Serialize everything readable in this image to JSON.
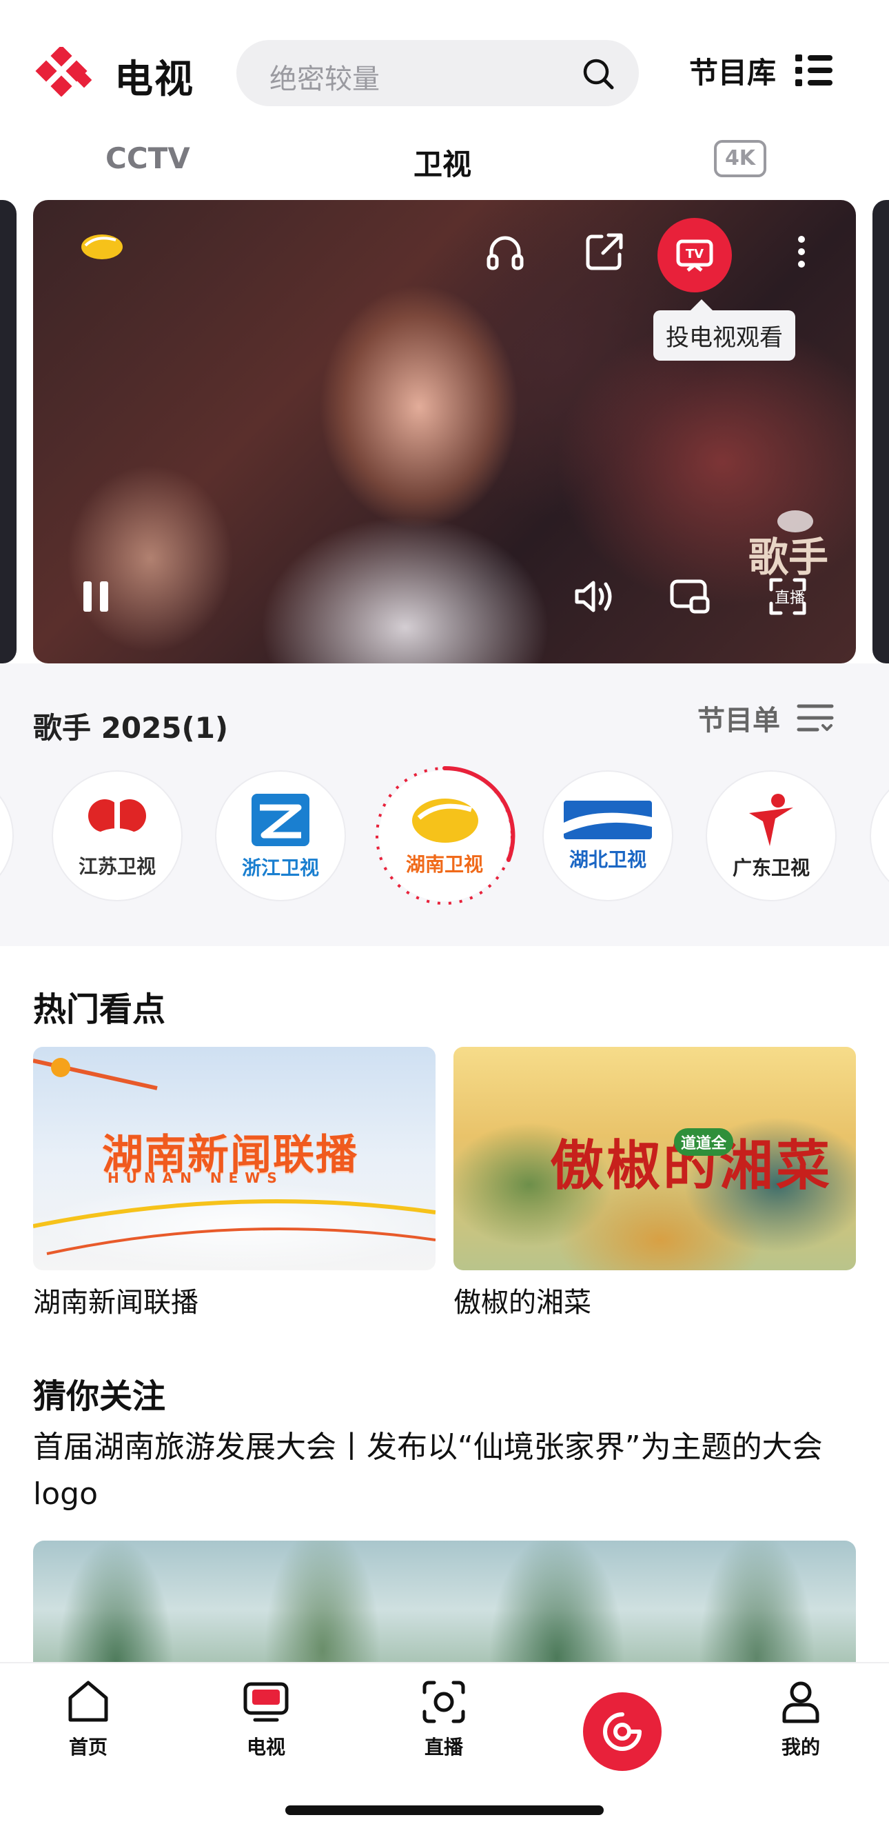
{
  "header": {
    "app_title": "电视",
    "search_placeholder": "绝密较量",
    "library_label": "节目库"
  },
  "tabs": {
    "cctv": "CCTV",
    "weishi": "卫视",
    "fourk": "4K",
    "active": "卫视"
  },
  "player": {
    "cast_tooltip": "投电视观看",
    "show_logo_text": "歌手",
    "show_logo_sub": "直播"
  },
  "program": {
    "title": "歌手 2025(1)",
    "schedule_label": "节目单",
    "channels": [
      {
        "name": "江苏卫视",
        "color": "#e02525"
      },
      {
        "name": "浙江卫视",
        "color": "#1a7fd0"
      },
      {
        "name": "湖南卫视",
        "color": "#f06a1a",
        "active": true
      },
      {
        "name": "湖北卫视",
        "color": "#1a66c4"
      },
      {
        "name": "广东卫视",
        "color": "#e0202a"
      }
    ]
  },
  "hot": {
    "title": "热门看点",
    "cards": [
      {
        "label": "湖南新闻联播",
        "headline": "湖南新闻联播",
        "sub": "HUNAN NEWS"
      },
      {
        "label": "傲椒的湘菜",
        "headline": "傲椒的湘菜",
        "badge": "道道全"
      }
    ]
  },
  "recommend": {
    "title": "猜你关注",
    "text": "首届湖南旅游发展大会丨发布以“仙境张家界”为主题的大会 logo"
  },
  "nav": {
    "home": "首页",
    "tv": "电视",
    "live": "直播",
    "mine": "我的"
  },
  "colors": {
    "accent": "#e8213a"
  }
}
